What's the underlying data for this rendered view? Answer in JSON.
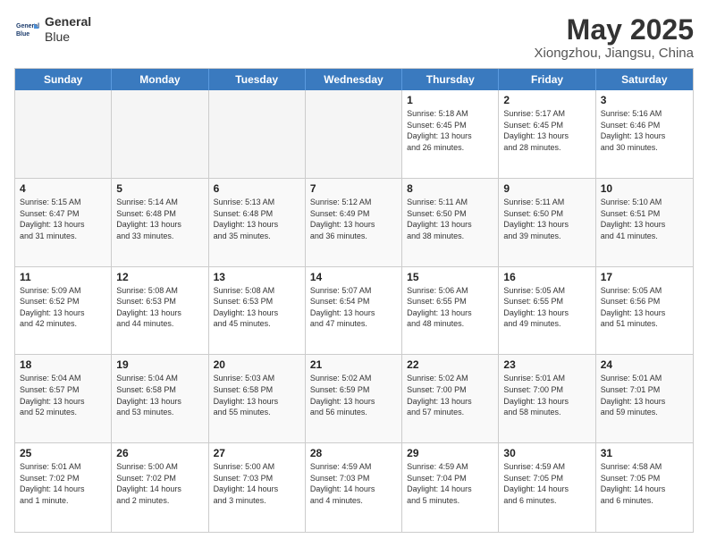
{
  "logo": {
    "line1": "General",
    "line2": "Blue"
  },
  "title": "May 2025",
  "location": "Xiongzhou, Jiangsu, China",
  "days_of_week": [
    "Sunday",
    "Monday",
    "Tuesday",
    "Wednesday",
    "Thursday",
    "Friday",
    "Saturday"
  ],
  "weeks": [
    [
      {
        "day": "",
        "detail": "",
        "empty": true
      },
      {
        "day": "",
        "detail": "",
        "empty": true
      },
      {
        "day": "",
        "detail": "",
        "empty": true
      },
      {
        "day": "",
        "detail": "",
        "empty": true
      },
      {
        "day": "1",
        "detail": "Sunrise: 5:18 AM\nSunset: 6:45 PM\nDaylight: 13 hours\nand 26 minutes."
      },
      {
        "day": "2",
        "detail": "Sunrise: 5:17 AM\nSunset: 6:45 PM\nDaylight: 13 hours\nand 28 minutes."
      },
      {
        "day": "3",
        "detail": "Sunrise: 5:16 AM\nSunset: 6:46 PM\nDaylight: 13 hours\nand 30 minutes."
      }
    ],
    [
      {
        "day": "4",
        "detail": "Sunrise: 5:15 AM\nSunset: 6:47 PM\nDaylight: 13 hours\nand 31 minutes."
      },
      {
        "day": "5",
        "detail": "Sunrise: 5:14 AM\nSunset: 6:48 PM\nDaylight: 13 hours\nand 33 minutes."
      },
      {
        "day": "6",
        "detail": "Sunrise: 5:13 AM\nSunset: 6:48 PM\nDaylight: 13 hours\nand 35 minutes."
      },
      {
        "day": "7",
        "detail": "Sunrise: 5:12 AM\nSunset: 6:49 PM\nDaylight: 13 hours\nand 36 minutes."
      },
      {
        "day": "8",
        "detail": "Sunrise: 5:11 AM\nSunset: 6:50 PM\nDaylight: 13 hours\nand 38 minutes."
      },
      {
        "day": "9",
        "detail": "Sunrise: 5:11 AM\nSunset: 6:50 PM\nDaylight: 13 hours\nand 39 minutes."
      },
      {
        "day": "10",
        "detail": "Sunrise: 5:10 AM\nSunset: 6:51 PM\nDaylight: 13 hours\nand 41 minutes."
      }
    ],
    [
      {
        "day": "11",
        "detail": "Sunrise: 5:09 AM\nSunset: 6:52 PM\nDaylight: 13 hours\nand 42 minutes."
      },
      {
        "day": "12",
        "detail": "Sunrise: 5:08 AM\nSunset: 6:53 PM\nDaylight: 13 hours\nand 44 minutes."
      },
      {
        "day": "13",
        "detail": "Sunrise: 5:08 AM\nSunset: 6:53 PM\nDaylight: 13 hours\nand 45 minutes."
      },
      {
        "day": "14",
        "detail": "Sunrise: 5:07 AM\nSunset: 6:54 PM\nDaylight: 13 hours\nand 47 minutes."
      },
      {
        "day": "15",
        "detail": "Sunrise: 5:06 AM\nSunset: 6:55 PM\nDaylight: 13 hours\nand 48 minutes."
      },
      {
        "day": "16",
        "detail": "Sunrise: 5:05 AM\nSunset: 6:55 PM\nDaylight: 13 hours\nand 49 minutes."
      },
      {
        "day": "17",
        "detail": "Sunrise: 5:05 AM\nSunset: 6:56 PM\nDaylight: 13 hours\nand 51 minutes."
      }
    ],
    [
      {
        "day": "18",
        "detail": "Sunrise: 5:04 AM\nSunset: 6:57 PM\nDaylight: 13 hours\nand 52 minutes."
      },
      {
        "day": "19",
        "detail": "Sunrise: 5:04 AM\nSunset: 6:58 PM\nDaylight: 13 hours\nand 53 minutes."
      },
      {
        "day": "20",
        "detail": "Sunrise: 5:03 AM\nSunset: 6:58 PM\nDaylight: 13 hours\nand 55 minutes."
      },
      {
        "day": "21",
        "detail": "Sunrise: 5:02 AM\nSunset: 6:59 PM\nDaylight: 13 hours\nand 56 minutes."
      },
      {
        "day": "22",
        "detail": "Sunrise: 5:02 AM\nSunset: 7:00 PM\nDaylight: 13 hours\nand 57 minutes."
      },
      {
        "day": "23",
        "detail": "Sunrise: 5:01 AM\nSunset: 7:00 PM\nDaylight: 13 hours\nand 58 minutes."
      },
      {
        "day": "24",
        "detail": "Sunrise: 5:01 AM\nSunset: 7:01 PM\nDaylight: 13 hours\nand 59 minutes."
      }
    ],
    [
      {
        "day": "25",
        "detail": "Sunrise: 5:01 AM\nSunset: 7:02 PM\nDaylight: 14 hours\nand 1 minute."
      },
      {
        "day": "26",
        "detail": "Sunrise: 5:00 AM\nSunset: 7:02 PM\nDaylight: 14 hours\nand 2 minutes."
      },
      {
        "day": "27",
        "detail": "Sunrise: 5:00 AM\nSunset: 7:03 PM\nDaylight: 14 hours\nand 3 minutes."
      },
      {
        "day": "28",
        "detail": "Sunrise: 4:59 AM\nSunset: 7:03 PM\nDaylight: 14 hours\nand 4 minutes."
      },
      {
        "day": "29",
        "detail": "Sunrise: 4:59 AM\nSunset: 7:04 PM\nDaylight: 14 hours\nand 5 minutes."
      },
      {
        "day": "30",
        "detail": "Sunrise: 4:59 AM\nSunset: 7:05 PM\nDaylight: 14 hours\nand 6 minutes."
      },
      {
        "day": "31",
        "detail": "Sunrise: 4:58 AM\nSunset: 7:05 PM\nDaylight: 14 hours\nand 6 minutes."
      }
    ]
  ]
}
